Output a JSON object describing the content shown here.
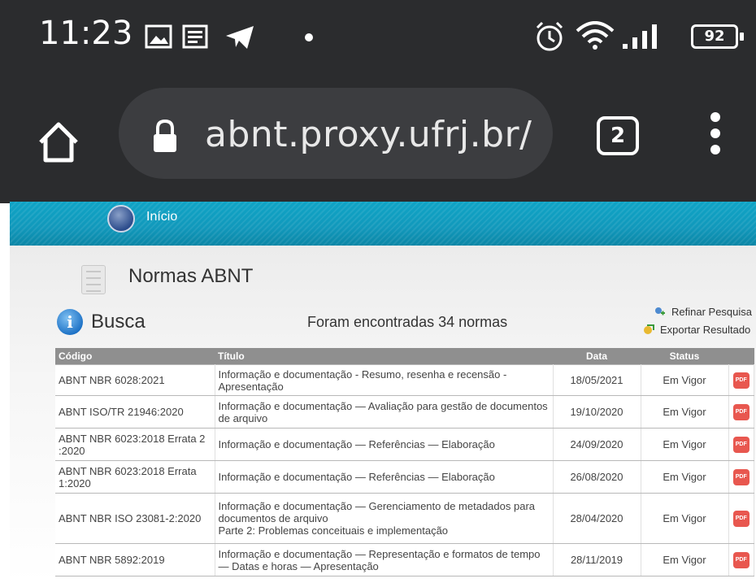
{
  "status_bar": {
    "time": "11:23",
    "battery": "92"
  },
  "browser": {
    "url": "abnt.proxy.ufrj.br/",
    "tab_count": "2"
  },
  "nav": {
    "home_label": "Início"
  },
  "page": {
    "title": "Normas ABNT",
    "section": "Busca",
    "result_summary": "Foram encontradas 34 normas",
    "refine_label": "Refinar Pesquisa",
    "export_label": "Exportar Resultado"
  },
  "table": {
    "headers": [
      "Código",
      "Título",
      "Data",
      "Status",
      ""
    ],
    "rows": [
      {
        "code": "ABNT NBR 6028:2021",
        "title": "Informação e documentação - Resumo, resenha e recensão - Apresentação",
        "date": "18/05/2021",
        "status": "Em Vigor"
      },
      {
        "code": "ABNT ISO/TR 21946:2020",
        "title": "Informação e documentação — Avaliação para gestão de documentos de arquivo",
        "date": "19/10/2020",
        "status": "Em Vigor"
      },
      {
        "code": "ABNT NBR 6023:2018 Errata 2 :2020",
        "title": "Informação e documentação — Referências — Elaboração",
        "date": "24/09/2020",
        "status": "Em Vigor"
      },
      {
        "code": "ABNT NBR 6023:2018 Errata 1:2020",
        "title": "Informação e documentação — Referências — Elaboração",
        "date": "26/08/2020",
        "status": "Em Vigor"
      },
      {
        "code": "ABNT NBR ISO 23081-2:2020",
        "title": "Informação e documentação — Gerenciamento de metadados para documentos de arquivo",
        "title2": "Parte 2: Problemas conceituais e implementação",
        "date": "28/04/2020",
        "status": "Em Vigor"
      },
      {
        "code": "ABNT NBR 5892:2019",
        "title": "Informação e documentação — Representação e formatos de tempo — Datas e horas — Apresentação",
        "date": "28/11/2019",
        "status": "Em Vigor"
      }
    ],
    "pdf_label": "PDF"
  },
  "colors": {
    "status_bar_bg": "#2b2c2e",
    "nav_band": "#1198bb",
    "table_header": "#8f8f8f",
    "pdf_red": "#e8574f"
  }
}
